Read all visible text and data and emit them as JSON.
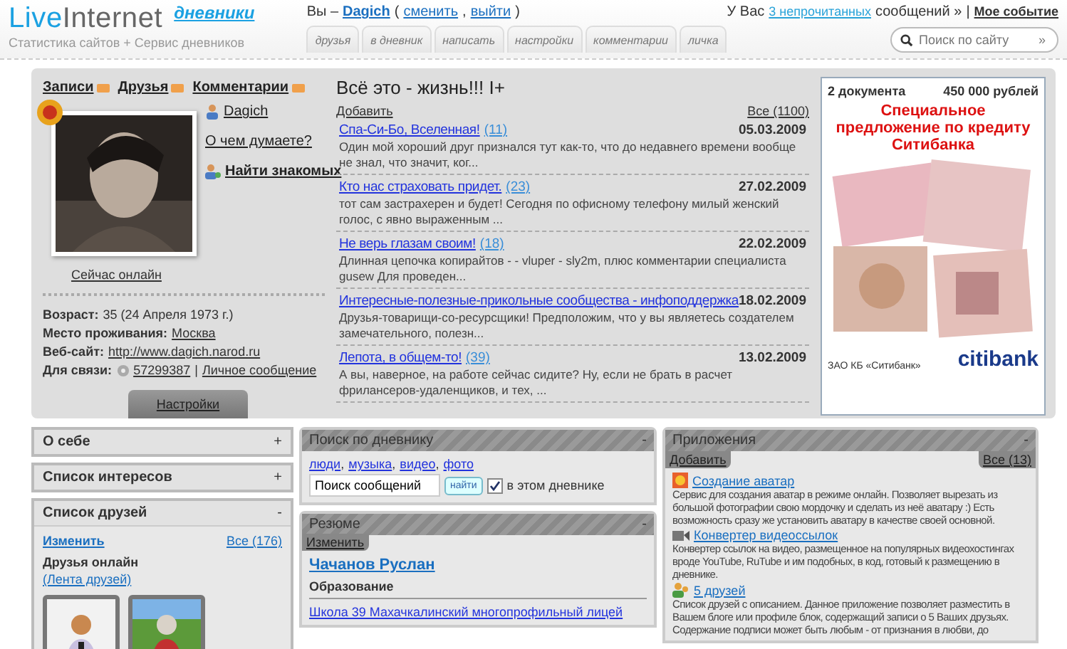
{
  "header": {
    "logo_a": "Live",
    "logo_b": "Internet",
    "logo_sub": "дневники",
    "tagline": "Статистика сайтов + Сервис дневников",
    "user_bar": {
      "prefix": "Вы –",
      "name": "Dagich",
      "open": "(",
      "links": [
        "сменить",
        "выйти"
      ],
      "sep": ",",
      "close": ")"
    },
    "messages": {
      "prefix": "У Вас",
      "link": "3 непрочитанных",
      "suffix": "сообщений »",
      "divider": "|",
      "event": "Мое событие"
    },
    "search": {
      "placeholder": "Поиск по сайту",
      "go": "»"
    },
    "tabs": [
      "друзья",
      "в дневник",
      "написать",
      "настройки",
      "комментарии",
      "личка"
    ]
  },
  "profile": {
    "feeds": [
      "Записи",
      "Друзья",
      "Комментарии"
    ],
    "user": "Dagich",
    "think": "О чем думаете?",
    "find": "Найти знакомых",
    "status": "Сейчас онлайн",
    "details": [
      {
        "label": "Возраст:",
        "value": "35 (24 Апреля 1973 г.)",
        "link": false
      },
      {
        "label": "Место проживания:",
        "value": "Москва",
        "link": true
      },
      {
        "label": "Веб-сайт:",
        "value": "http://www.dagich.narod.ru",
        "link": true
      }
    ],
    "contact": {
      "label": "Для связи:",
      "number": "57299387",
      "divider": "|",
      "message": "Личное сообщение"
    },
    "settings": "Настройки"
  },
  "diary": {
    "title": "Всё это - жизнь!!! I+",
    "add": "Добавить",
    "all": "Все (1100)",
    "posts": [
      {
        "title": "Спа-Си-Бо, Вселенная!",
        "count": "(11)",
        "date": "05.03.2009",
        "excerpt": "Один мой хороший друг признался тут как-то, что до недавнего времени вообще не знал, что значит, ког..."
      },
      {
        "title": "Кто нас страховать придет.",
        "count": "(23)",
        "date": "27.02.2009",
        "excerpt": "тот сам застрахерен и будет! Сегодня по офисному телефону милый женский голос, с явно выраженным ..."
      },
      {
        "title": "Не верь глазам своим!",
        "count": "(18)",
        "date": "22.02.2009",
        "excerpt": "Длинная цепочка копирайтов - - vluper - sly2m, плюс комментарии специалиста gusew Для проведен..."
      },
      {
        "title": "Интересные-полезные-прикольные сообщества - инфоподдержка",
        "date": "18.02.2009",
        "excerpt": "Друзья-товарищи-со-ресурсщики! Предположим, что у вы являетесь создателем замечательного, полезн..."
      },
      {
        "title": "Лепота, в общем-то!",
        "count": "(39)",
        "date": "13.02.2009",
        "excerpt": "А вы, наверное, на работе сейчас сидите? Ну, если не брать в расчет фрилансеров-удаленщиков, и тех, ..."
      }
    ]
  },
  "ad": {
    "left": "2 документа",
    "right": "450 000 рублей",
    "headline": "Специальное предложение по кредиту Ситибанка",
    "footer": "ЗАО КБ «Ситибанк»",
    "brand": "citibank"
  },
  "sections": [
    {
      "title": "О себе",
      "toggle": "+",
      "expanded": false
    },
    {
      "title": "Список интересов",
      "toggle": "+",
      "expanded": false
    },
    {
      "title": "Список друзей",
      "toggle": "-",
      "expanded": true
    }
  ],
  "friends": {
    "edit": "Изменить",
    "all": "Все (176)",
    "online": "Друзья онлайн",
    "feed": "(Лента друзей)"
  },
  "search_panel": {
    "title": "Поиск по дневнику",
    "toggle": "-",
    "links": [
      "люди",
      "музыка",
      "видео",
      "фото"
    ],
    "sep": ",",
    "value": "Поиск сообщений",
    "button": "найти",
    "scope": {
      "label": "в этом дневнике",
      "checked": true
    }
  },
  "resume": {
    "title": "Резюме",
    "toggle": "-",
    "edit": "Изменить",
    "name": "Чачанов Руслан",
    "section": "Образование",
    "school": "Школа 39 Махачкалинский многопрофильный лицей"
  },
  "apps": {
    "title": "Приложения",
    "toggle": "-",
    "add": "Добавить",
    "all": "Все (13)",
    "items": [
      {
        "kind": "avatar",
        "title": "Создание аватар",
        "desc": "Сервис для создания аватар в режиме онлайн. Позволяет вырезать из большой фотографии свою мордочку и сделать из неё аватару :) Есть возможность сразу же установить аватару в качестве своей основной."
      },
      {
        "kind": "video",
        "title": "Конвертер видеоссылок",
        "desc": "Конвертер ссылок на видео, размещенное на популярных видеохостингах вроде YouTube, RuTube и им подобных, в код, готовый к размещению в дневнике."
      },
      {
        "kind": "friends",
        "title": "5 друзей",
        "desc": "Список друзей с описанием. Данное приложение позволяет разместить в Вашем блоге или профиле блок, содержащий записи о 5 Ваших друзьях. Содержание подписи может быть любым - от признания в любви, до"
      }
    ]
  }
}
